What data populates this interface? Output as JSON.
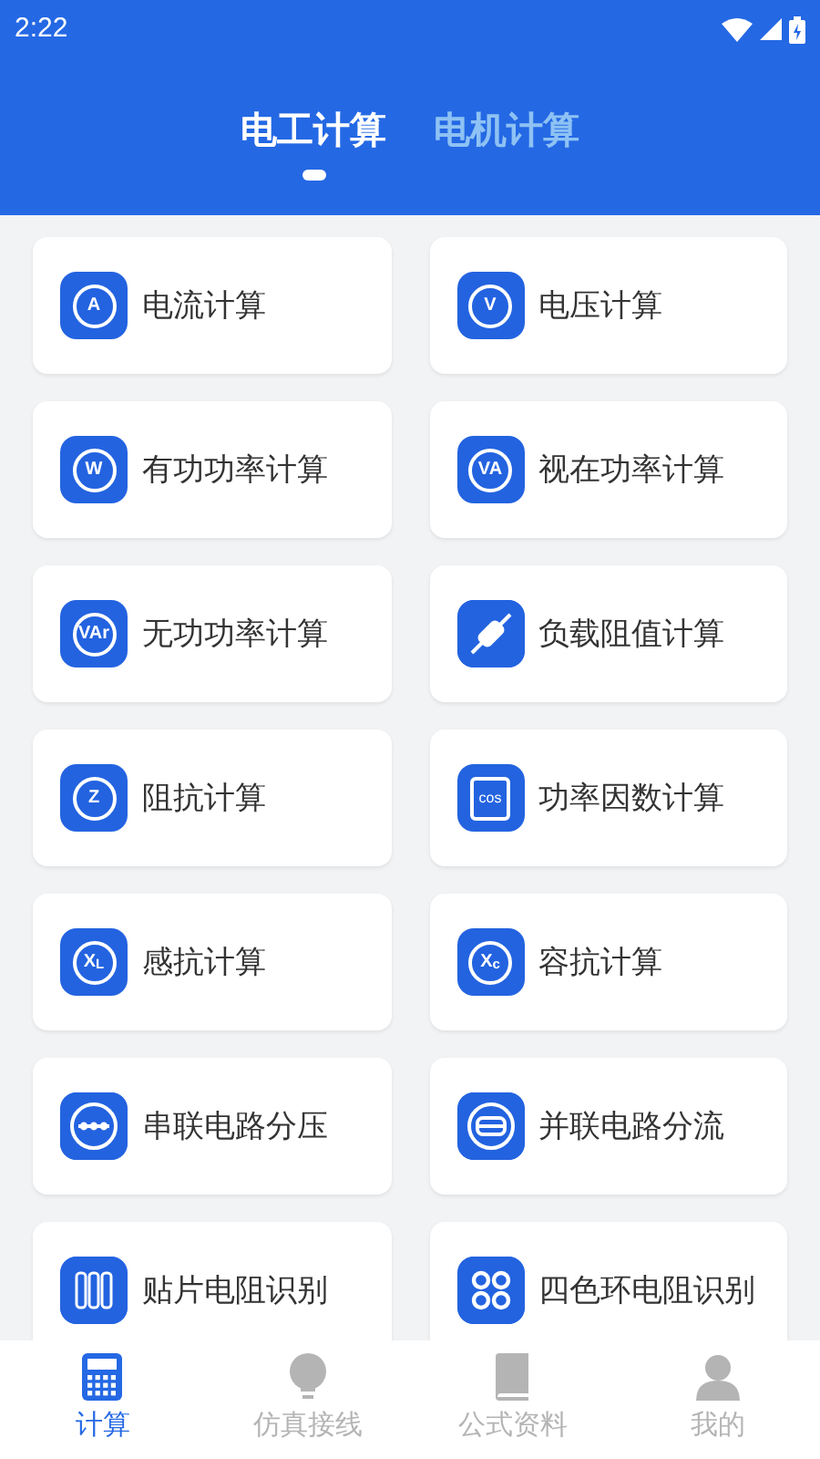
{
  "status_bar": {
    "time": "2:22"
  },
  "tabs": [
    {
      "label": "电工计算",
      "selected": true
    },
    {
      "label": "电机计算",
      "selected": false
    }
  ],
  "items": [
    {
      "label": "电流计算",
      "icon": {
        "kind": "letter",
        "text": "A"
      }
    },
    {
      "label": "电压计算",
      "icon": {
        "kind": "letter",
        "text": "V"
      }
    },
    {
      "label": "有功功率计算",
      "icon": {
        "kind": "letter",
        "text": "W"
      }
    },
    {
      "label": "视在功率计算",
      "icon": {
        "kind": "letter",
        "text": "VA"
      }
    },
    {
      "label": "无功功率计算",
      "icon": {
        "kind": "letter",
        "text": "VAr"
      }
    },
    {
      "label": "负载阻值计算",
      "icon": {
        "kind": "resistor"
      }
    },
    {
      "label": "阻抗计算",
      "icon": {
        "kind": "letter",
        "text": "Z"
      }
    },
    {
      "label": "功率因数计算",
      "icon": {
        "kind": "boxed",
        "text": "cos"
      }
    },
    {
      "label": "感抗计算",
      "icon": {
        "kind": "letter",
        "text": "X$_{L}$"
      }
    },
    {
      "label": "容抗计算",
      "icon": {
        "kind": "letter",
        "text": "X$_{c}$"
      }
    },
    {
      "label": "串联电路分压",
      "icon": {
        "kind": "series"
      }
    },
    {
      "label": "并联电路分流",
      "icon": {
        "kind": "parallel"
      }
    },
    {
      "label": "贴片电阻识别",
      "icon": {
        "kind": "chip"
      }
    },
    {
      "label": "四色环电阻识别",
      "icon": {
        "kind": "rings"
      }
    }
  ],
  "nav": [
    {
      "label": "计算",
      "kind": "calculator",
      "selected": true
    },
    {
      "label": "仿真接线",
      "kind": "bulb",
      "selected": false
    },
    {
      "label": "公式资料",
      "kind": "book",
      "selected": false
    },
    {
      "label": "我的",
      "kind": "person",
      "selected": false
    }
  ]
}
